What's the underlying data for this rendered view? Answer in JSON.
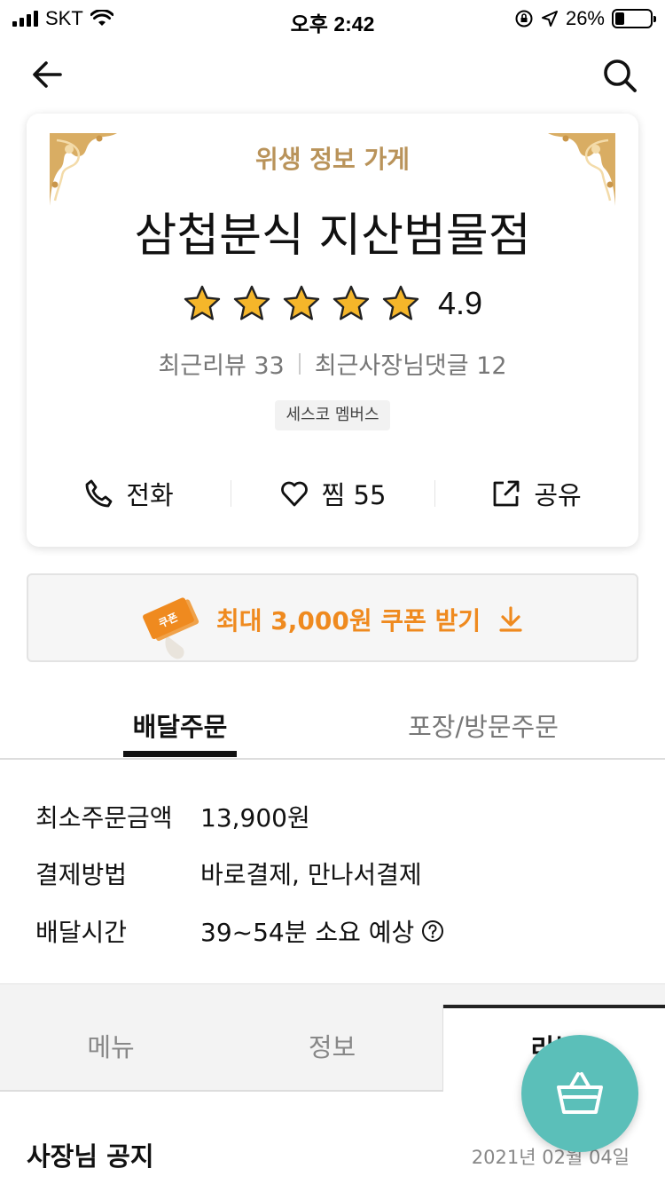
{
  "status_bar": {
    "carrier": "SKT",
    "time": "오후 2:42",
    "battery": "26%",
    "battery_level": 0.26
  },
  "nav": {
    "back_icon": "arrow-left-icon",
    "search_icon": "search-icon"
  },
  "store": {
    "hygiene_label": "위생 정보 가게",
    "name": "삼첩분식 지산범물점",
    "rating": "4.9",
    "stars": 5,
    "recent_reviews": "최근리뷰 33",
    "owner_replies": "최근사장님댓글 12",
    "badge": "세스코 멤버스",
    "actions": {
      "call": "전화",
      "like": "찜 55",
      "share": "공유"
    }
  },
  "coupon": {
    "label": "최대 3,000원 쿠폰 받기",
    "ticket_text": "쿠폰",
    "color": "#ef8a1f"
  },
  "order_tabs": {
    "delivery": "배달주문",
    "pickup": "포장/방문주문"
  },
  "info": {
    "min_order_label": "최소주문금액",
    "min_order_value": "13,900원",
    "payment_label": "결제방법",
    "payment_value": "바로결제, 만나서결제",
    "delivery_time_label": "배달시간",
    "delivery_time_value": "39~54분 소요 예상"
  },
  "menu_tabs": {
    "menu": "메뉴",
    "info": "정보",
    "review": "리뷰"
  },
  "notice": {
    "title": "사장님 공지",
    "date": "2021년 02월 04일"
  },
  "colors": {
    "accent_teal": "#5bbfb9",
    "hygiene_gold": "#b9935a",
    "star_gold": "#f5b62a"
  }
}
